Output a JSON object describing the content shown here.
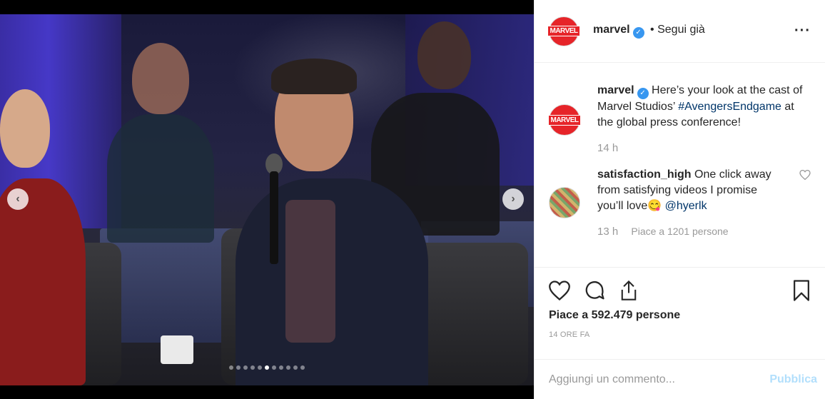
{
  "post": {
    "username": "marvel",
    "follow_status": "• Segui già",
    "avatar_text": "MARVEL"
  },
  "photo": {
    "carousel_dots": 11,
    "active_dot": 5
  },
  "caption": {
    "username": "marvel",
    "text_before": "Here’s your look at the cast of Marvel Studios’",
    "hashtag": "#AvengersEndgame",
    "text_after": "at the global press conference!",
    "time": "14 h"
  },
  "comment": {
    "username": "satisfaction_high",
    "text": "One click away from satisfying videos I promise you’ll love",
    "emoji": "😋",
    "mention": "@hyerlk",
    "time": "13 h",
    "likes": "Piace a 1201 persone"
  },
  "likes_text_prefix": "Piace a",
  "likes_count": "592.479",
  "likes_text_suffix": "persone",
  "date": "14 ORE FA",
  "add_comment": {
    "placeholder": "Aggiungi un commento...",
    "publish_label": "Pubblica"
  },
  "icons": [
    "heart-icon",
    "comment-icon",
    "share-icon",
    "bookmark-icon",
    "more-icon",
    "chevron-left-icon",
    "chevron-right-icon",
    "verified-icon"
  ],
  "colors": {
    "brand_red": "#e62429",
    "link_blue": "#003569",
    "verified_blue": "#3897f0",
    "muted": "#999999",
    "publish_disabled": "#b2dffc"
  }
}
